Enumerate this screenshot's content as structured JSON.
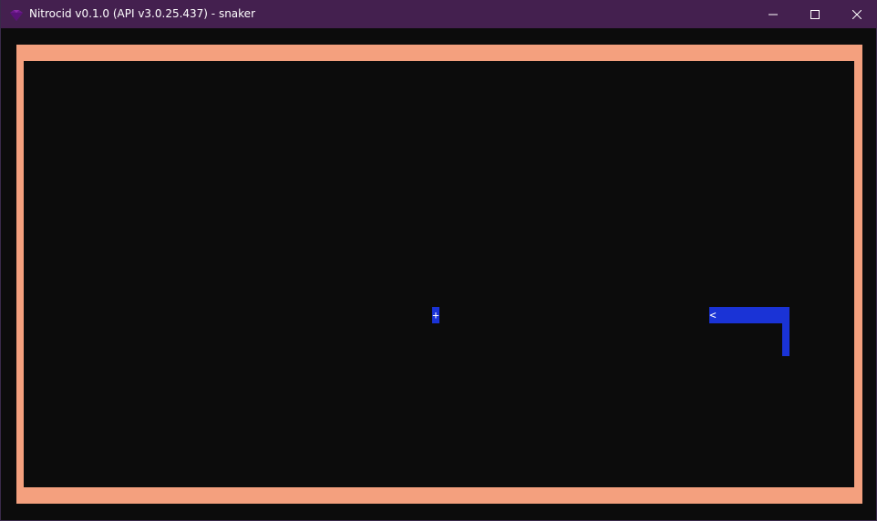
{
  "window": {
    "title": "Nitrocid v0.1.0 (API v3.0.25.437) - snaker",
    "app_icon": "nitrocid-icon",
    "controls": {
      "minimize": "minimize-icon",
      "maximize": "maximize-icon",
      "close": "close-icon"
    }
  },
  "game": {
    "name": "snaker",
    "food_glyph": "+",
    "snake_head_glyph": "<",
    "colors": {
      "border": "#f4a07e",
      "background": "#0c0c0c",
      "snake": "#1a33d6",
      "food": "#1a33d6",
      "titlebar": "#44204f"
    }
  }
}
